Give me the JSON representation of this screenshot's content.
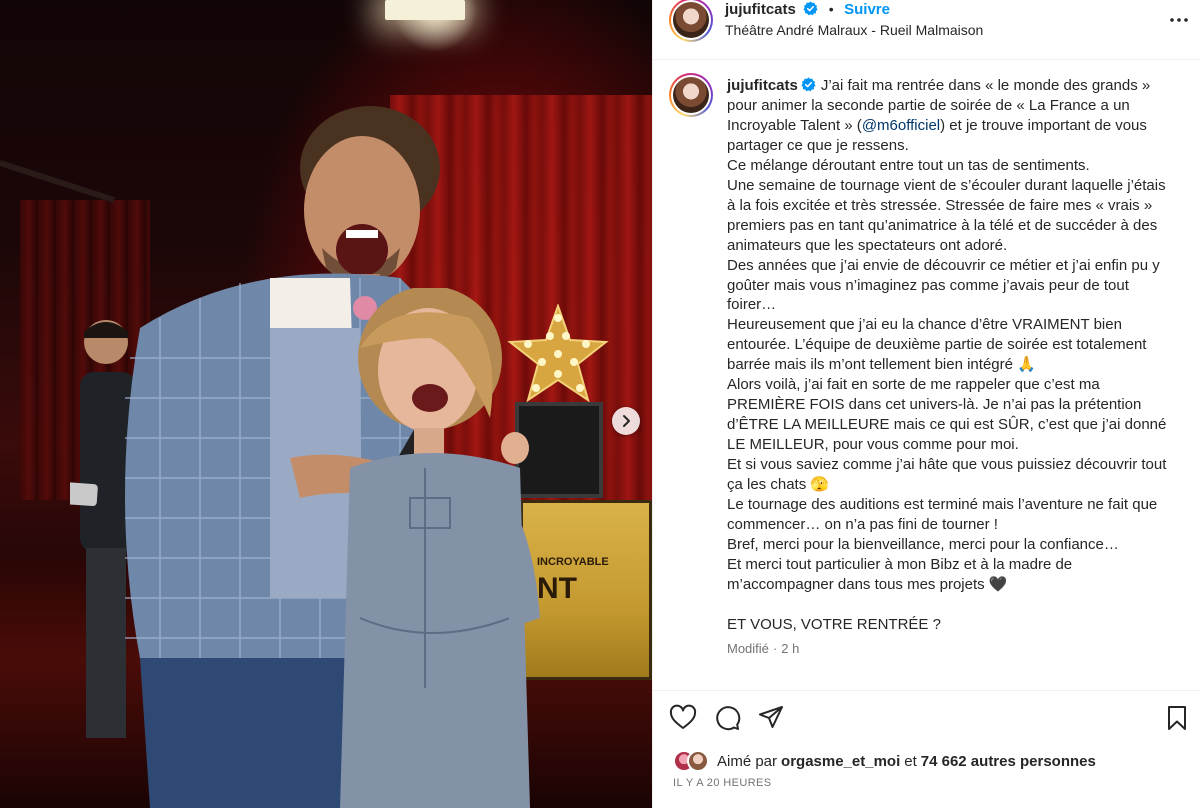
{
  "header": {
    "username": "jujufitcats",
    "separator": "•",
    "follow_label": "Suivre",
    "location": "Théâtre André Malraux - Rueil Malmaison"
  },
  "caption": {
    "username": "jujufitcats",
    "intro": "J’ai fait ma rentrée dans « le monde des grands » pour animer la seconde partie de soirée de « La France a un Incroyable Talent » (",
    "mention": "@m6officiel",
    "intro_end": ") et je trouve important de vous partager ce que je ressens.",
    "lines": [
      "Ce mélange déroutant entre tout un tas de sentiments.",
      "Une semaine de tournage vient de s’écouler durant laquelle j’étais à la fois excitée et très stressée. Stressée de faire mes « vrais » premiers pas en tant qu’animatrice à la télé et de succéder à des animateurs que les spectateurs ont adoré.",
      "Des années que j’ai envie de découvrir ce métier et j’ai enfin pu y goûter mais vous n’imaginez pas comme j’avais peur de tout foirer…",
      "Heureusement que j’ai eu la chance d’être VRAIMENT bien entourée. L’équipe de deuxième partie de soirée est totalement barrée mais ils m’ont tellement bien intégré 🙏",
      "Alors voilà, j’ai fait en sorte de me rappeler que c’est ma PREMIÈRE FOIS dans cet univers-là. Je n’ai pas la prétention d’ÊTRE LA MEILLEURE mais ce qui est SÛR, c’est que j’ai donné LE MEILLEUR, pour vous comme pour moi.",
      "Et si vous saviez comme j’ai hâte que vous puissiez découvrir tout ça les chats 🫣",
      "Le tournage des auditions est terminé mais l’aventure ne fait que commencer… on n’a pas fini de tourner !",
      "Bref, merci pour la bienveillance, merci pour la confiance…",
      "Et merci tout particulier à mon Bibz et à la madre de m’accompagner dans tous mes projets 🖤"
    ],
    "closing": "ET VOUS, VOTRE RENTRÉE ?",
    "modified_label": "Modifié",
    "modified_sep": "·",
    "modified_time": "2 h"
  },
  "photo": {
    "case_text_line1": "INCROYABLE",
    "case_text_line2": "NT"
  },
  "likes": {
    "prefix": "Aimé par",
    "user": "orgasme_et_moi",
    "middle": "et",
    "count": "74 662 autres personnes"
  },
  "time_ago": "IL Y A 20 HEURES",
  "icons": {
    "like": "heart-icon",
    "comment": "comment-icon",
    "share": "send-icon",
    "save": "bookmark-icon",
    "more": "more-dots-icon",
    "verified": "verified-badge-icon",
    "next": "chevron-right-icon"
  },
  "colors": {
    "follow": "#0095f6",
    "verified": "#0095f6",
    "text": "#262626",
    "muted": "#737373"
  }
}
